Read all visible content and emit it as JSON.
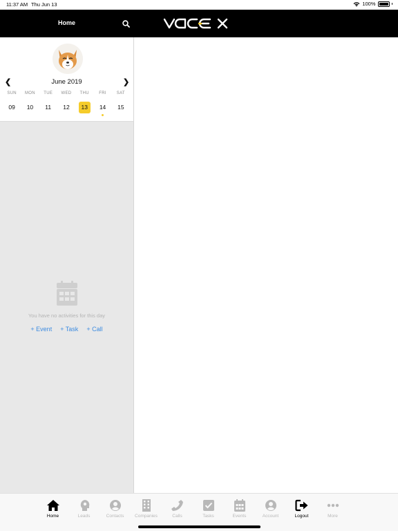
{
  "status_bar": {
    "time": "11:37 AM",
    "date": "Thu Jun 13",
    "battery": "100%"
  },
  "header": {
    "home_label": "Home",
    "logo_text": "vac-ex",
    "brand_color": "#000000"
  },
  "calendar": {
    "month_label": "June 2019",
    "weekdays": [
      "SUN",
      "MON",
      "TUE",
      "WED",
      "THU",
      "FRI",
      "SAT"
    ],
    "dates": [
      "09",
      "10",
      "11",
      "12",
      "13",
      "14",
      "15"
    ],
    "selected_date": "13",
    "has_event_dot": "14",
    "highlight_color": "#f5cc2b"
  },
  "empty_state": {
    "message": "You have no activities for this day",
    "add_event": "+ Event",
    "add_task": "+ Task",
    "add_call": "+ Call",
    "link_color": "#3d8be0"
  },
  "tabbar": {
    "items": [
      {
        "label": "Home",
        "icon": "home-icon",
        "active": true
      },
      {
        "label": "Leads",
        "icon": "head-icon",
        "active": false
      },
      {
        "label": "Contacts",
        "icon": "user-circle-icon",
        "active": false
      },
      {
        "label": "Companies",
        "icon": "building-icon",
        "active": false
      },
      {
        "label": "Calls",
        "icon": "phone-icon",
        "active": false
      },
      {
        "label": "Tasks",
        "icon": "checkbox-icon",
        "active": false
      },
      {
        "label": "Events",
        "icon": "calendar-icon",
        "active": false
      },
      {
        "label": "Account",
        "icon": "account-icon",
        "active": false
      },
      {
        "label": "Logout",
        "icon": "logout-icon",
        "active": true
      },
      {
        "label": "More",
        "icon": "more-icon",
        "active": false
      }
    ]
  }
}
